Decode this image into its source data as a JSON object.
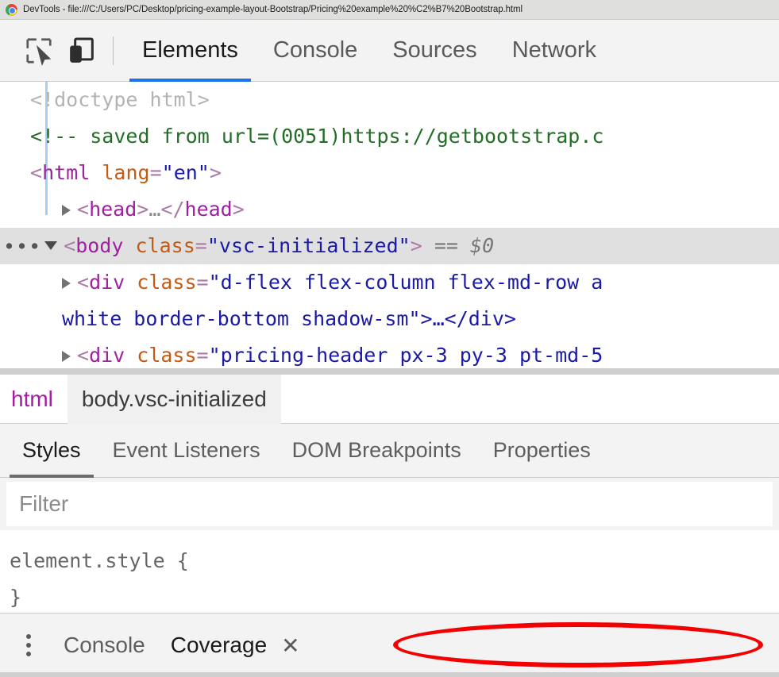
{
  "window": {
    "title": "DevTools - file:///C:/Users/PC/Desktop/pricing-example-layout-Bootstrap/Pricing%20example%20%C2%B7%20Bootstrap.html",
    "logo_icon": "chrome-logo-icon"
  },
  "toolbar": {
    "inspect_icon": "inspect-element-icon",
    "device_icon": "device-toolbar-icon",
    "tabs": [
      {
        "label": "Elements",
        "active": true
      },
      {
        "label": "Console",
        "active": false
      },
      {
        "label": "Sources",
        "active": false
      },
      {
        "label": "Network",
        "active": false
      }
    ]
  },
  "dom_tree": {
    "rows": [
      {
        "text": "<!doctype html>"
      },
      {
        "text": "<!-- saved from url=(0051)https://getbootstrap.c"
      },
      {
        "tag": "html",
        "attr": "lang",
        "value": "en"
      },
      {
        "tag": "head"
      },
      {
        "tag": "body",
        "attr": "class",
        "value": "vsc-initialized",
        "suffix": "== $0",
        "selected": true
      },
      {
        "tag": "div",
        "attr": "class",
        "value": "d-flex flex-column flex-md-row a"
      },
      {
        "continuation": "white border-bottom shadow-sm\">…</div>"
      },
      {
        "tag": "div",
        "attr": "class",
        "value": "pricing-header px-3 py-3 pt-md-5"
      }
    ]
  },
  "breadcrumb": {
    "items": [
      {
        "label": "html",
        "selected": false
      },
      {
        "label": "body.vsc-initialized",
        "selected": true
      }
    ]
  },
  "styles_panel": {
    "tabs": [
      {
        "label": "Styles",
        "active": true
      },
      {
        "label": "Event Listeners",
        "active": false
      },
      {
        "label": "DOM Breakpoints",
        "active": false
      },
      {
        "label": "Properties",
        "active": false
      }
    ],
    "filter_placeholder": "Filter",
    "filter_value": "",
    "rule": "element.style {",
    "rule_close": "}"
  },
  "drawer": {
    "menu_icon": "kebab-menu-icon",
    "tabs": [
      {
        "label": "Console",
        "active": false
      },
      {
        "label": "Coverage",
        "active": true
      }
    ],
    "close_label": "✕",
    "close_icon": "close-icon"
  },
  "annotation": {
    "shape": "ellipse",
    "color": "#f40000"
  }
}
